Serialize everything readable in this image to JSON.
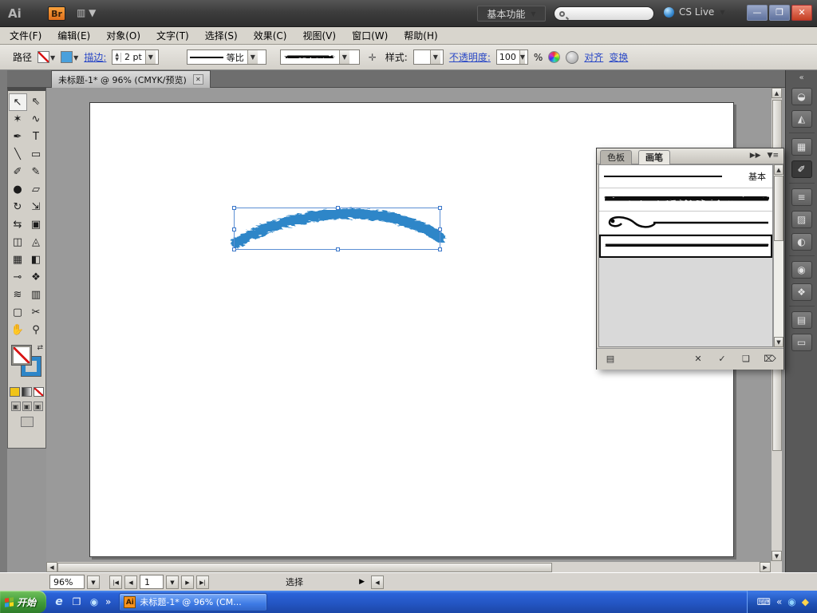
{
  "titlebar": {
    "app_logo": "Ai",
    "bridge_label": "Br",
    "arrange_glyph": "▥ ▼",
    "workspace_button": "基本功能",
    "search_value": "",
    "cs_live_label": "CS Live",
    "minimize_glyph": "—",
    "restore_glyph": "❐",
    "close_glyph": "✕"
  },
  "menubar": {
    "items": [
      "文件(F)",
      "编辑(E)",
      "对象(O)",
      "文字(T)",
      "选择(S)",
      "效果(C)",
      "视图(V)",
      "窗口(W)",
      "帮助(H)"
    ]
  },
  "control_panel": {
    "path_label": "路径",
    "stroke_link": "描边:",
    "stroke_weight": "2 pt",
    "profile_value": "等比",
    "style_label": "样式:",
    "opacity_link": "不透明度:",
    "opacity_value": "100",
    "percent_label": "%",
    "align_link": "对齐",
    "transform_link": "变换"
  },
  "document_tab": {
    "title": "未标题-1* @ 96% (CMYK/预览)"
  },
  "icons": {
    "dd": "▼",
    "up": "▲",
    "left": "◀",
    "right": "▶",
    "first": "|◀",
    "last": "▶|",
    "close": "✕",
    "chevL": "«",
    "chevR": "»",
    "swap": "⇄",
    "stepper_up": "▲",
    "stepper_down": "▼",
    "panel_expand": "▶▶",
    "panel_menu": "▼≡",
    "options": "✛",
    "keyboard": "⌨"
  },
  "tools": [
    {
      "name": "selection-tool",
      "glyph": "↖"
    },
    {
      "name": "direct-selection-tool",
      "glyph": "⇖"
    },
    {
      "name": "magic-wand-tool",
      "glyph": "✶"
    },
    {
      "name": "lasso-tool",
      "glyph": "∿"
    },
    {
      "name": "pen-tool",
      "glyph": "✒"
    },
    {
      "name": "type-tool",
      "glyph": "T"
    },
    {
      "name": "line-segment-tool",
      "glyph": "╲"
    },
    {
      "name": "rectangle-tool",
      "glyph": "▭"
    },
    {
      "name": "paintbrush-tool",
      "glyph": "✐"
    },
    {
      "name": "pencil-tool",
      "glyph": "✎"
    },
    {
      "name": "blob-brush-tool",
      "glyph": "●"
    },
    {
      "name": "eraser-tool",
      "glyph": "▱"
    },
    {
      "name": "rotate-tool",
      "glyph": "↻"
    },
    {
      "name": "scale-tool",
      "glyph": "⇲"
    },
    {
      "name": "width-tool",
      "glyph": "⇆"
    },
    {
      "name": "free-transform-tool",
      "glyph": "▣"
    },
    {
      "name": "shape-builder-tool",
      "glyph": "◫"
    },
    {
      "name": "perspective-grid-tool",
      "glyph": "◬"
    },
    {
      "name": "mesh-tool",
      "glyph": "▦"
    },
    {
      "name": "gradient-tool",
      "glyph": "◧"
    },
    {
      "name": "eyedropper-tool",
      "glyph": "⊸"
    },
    {
      "name": "blend-tool",
      "glyph": "❖"
    },
    {
      "name": "symbol-sprayer-tool",
      "glyph": "≋"
    },
    {
      "name": "column-graph-tool",
      "glyph": "▥"
    },
    {
      "name": "artboard-tool",
      "glyph": "▢"
    },
    {
      "name": "slice-tool",
      "glyph": "✂"
    },
    {
      "name": "hand-tool",
      "glyph": "✋"
    },
    {
      "name": "zoom-tool",
      "glyph": "⚲"
    }
  ],
  "dock_icons": [
    {
      "name": "color",
      "glyph": "◒"
    },
    {
      "name": "color-guide",
      "glyph": "◭"
    },
    {
      "name": "swatches",
      "glyph": "▦"
    },
    {
      "name": "brushes",
      "glyph": "✐"
    },
    {
      "name": "stroke",
      "glyph": "≡"
    },
    {
      "name": "gradient",
      "glyph": "▨"
    },
    {
      "name": "transparency",
      "glyph": "◐"
    },
    {
      "name": "appearance",
      "glyph": "◉"
    },
    {
      "name": "graphic-styles",
      "glyph": "❖"
    },
    {
      "name": "layers",
      "glyph": "▤"
    },
    {
      "name": "artboards",
      "glyph": "▭"
    }
  ],
  "brushes_panel": {
    "tab_swatches": "色板",
    "tab_brushes": "画笔",
    "basic_brush_label": "基本",
    "bottom_icons": {
      "libraries": "▤",
      "remove_brush_stroke": "✕",
      "options_of_selected": "✓",
      "new_brush": "❑",
      "delete_brush": "⌦"
    }
  },
  "status_bar": {
    "zoom": "96%",
    "artboard_number": "1",
    "status_text": "选择"
  },
  "taskbar": {
    "start_label": "开始",
    "window_button": "未标题-1* @ 96% (CM...",
    "overflow": "»",
    "tray_collapse": "«"
  },
  "colors": {
    "artwork_stroke": "#2e86c8",
    "selection_blue": "#5b8fd4",
    "link_blue": "#2b49c6",
    "taskbar_blue": "#2456c4",
    "start_green": "#3f9a38"
  },
  "artwork": {
    "type": "blue-charcoal-brush-stroke",
    "selected": true
  }
}
